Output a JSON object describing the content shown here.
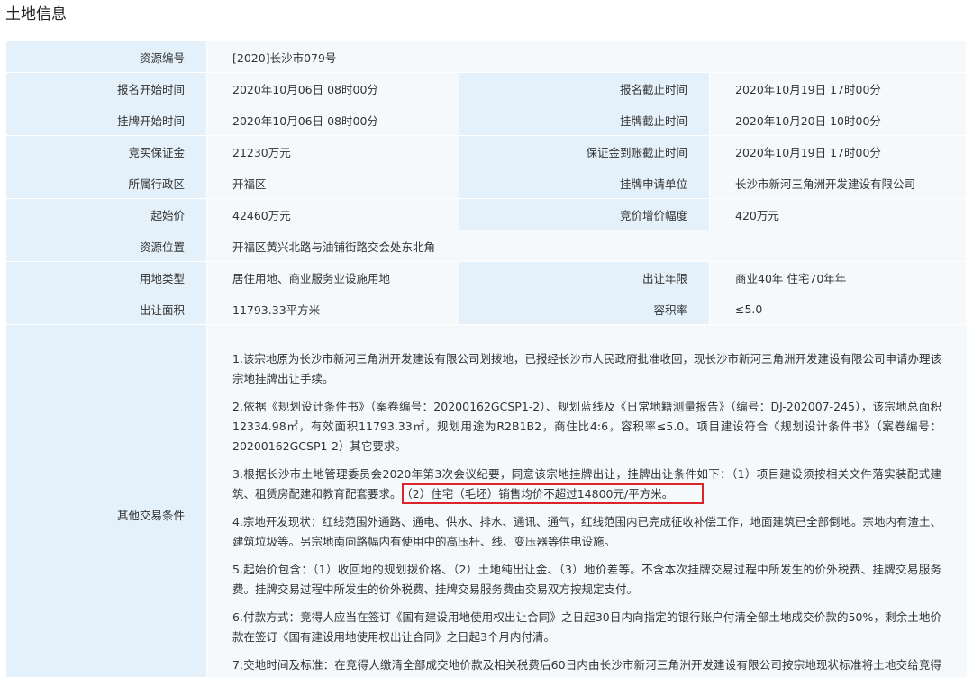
{
  "page": {
    "title": "土地信息"
  },
  "rows": [
    {
      "label": "资源编号",
      "value": "[2020]长沙市079号"
    },
    {
      "label": "报名开始时间",
      "value": "2020年10月06日 08时00分",
      "label2": "报名截止时间",
      "value2": "2020年10月19日 17时00分"
    },
    {
      "label": "挂牌开始时间",
      "value": "2020年10月06日 08时00分",
      "label2": "挂牌截止时间",
      "value2": "2020年10月20日 10时00分"
    },
    {
      "label": "竞买保证金",
      "value": "21230万元",
      "label2": "保证金到账截止时间",
      "value2": "2020年10月19日 17时00分"
    },
    {
      "label": "所属行政区",
      "value": "开福区",
      "label2": "挂牌申请单位",
      "value2": "长沙市新河三角洲开发建设有限公司"
    },
    {
      "label": "起始价",
      "value": "42460万元",
      "label2": "竞价增价幅度",
      "value2": "420万元"
    },
    {
      "label": "资源位置",
      "value": "开福区黄兴北路与油铺街路交会处东北角"
    },
    {
      "label": "用地类型",
      "value": "居住用地、商业服务业设施用地",
      "label2": "出让年限",
      "value2": "商业40年 住宅70年年"
    },
    {
      "label": "出让面积",
      "value": "11793.33平方米",
      "label2": "容积率",
      "value2": "≤5.0"
    }
  ],
  "other_conditions": {
    "label": "其他交易条件",
    "items": [
      "1.该宗地原为长沙市新河三角洲开发建设有限公司划拨地，已报经长沙市人民政府批准收回，现长沙市新河三角洲开发建设有限公司申请办理该宗地挂牌出让手续。",
      "2.依据《规划设计条件书》（案卷编号：20200162GCSP1-2）、规划蓝线及《日常地籍测量报告》（编号：DJ-202007-245），该宗地总面积12334.98㎡，有效面积11793.33㎡，规划用途为R2B1B2，商住比4:6，容积率≤5.0。项目建设符合《规划设计条件书》（案卷编号：20200162GCSP1-2）其它要求。",
      "",
      "4.宗地开发现状：红线范围外通路、通电、供水、排水、通讯、通气，红线范围内已完成征收补偿工作，地面建筑已全部倒地。宗地内有渣土、建筑垃圾等。另宗地南向路幅内有使用中的高压杆、线、变压器等供电设施。",
      "5.起始价包含：（1）收回地的规划拨价格、（2）土地纯出让金、（3）地价差等。不含本次挂牌交易过程中所发生的价外税费、挂牌交易服务费。挂牌交易过程中所发生的价外税费、挂牌交易服务费由交易双方按规定支付。",
      "6.付款方式：竞得人应当在签订《国有建设用地使用权出让合同》之日起30日内向指定的银行账户付清全部土地成交价款的50%，剩余土地价款在签订《国有建设用地使用权出让合同》之日起3个月内付清。",
      "7.交地时间及标准：在竞得人缴清全部成交地价款及相关税费后60日内由长沙市新河三角洲开发建设有限公司按宗地现状标准将土地交给竞得人。"
    ],
    "item3_main": "3.根据长沙市土地管理委员会2020年第3次会议纪要，同意该宗地挂牌出让，挂牌出让条件如下：（1）项目建设须按相关文件落实装配式建筑、租赁房配建和教育配套要求。",
    "item3_highlight": "（2）住宅（毛坯）销售均价不超过14800元/平方米。"
  },
  "colors": {
    "label_bg": "#e5f1fa",
    "value_bg": "#f5f9fc",
    "highlight_border": "#d9252a"
  }
}
